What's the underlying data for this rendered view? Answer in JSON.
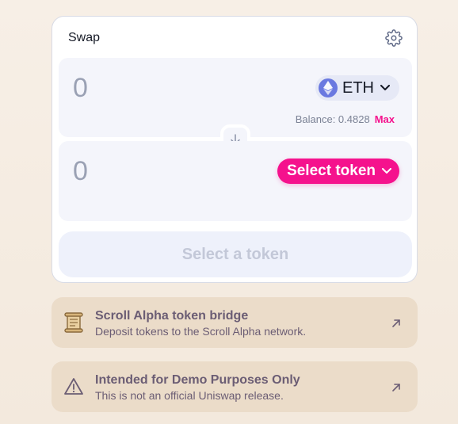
{
  "swap": {
    "title": "Swap",
    "input": {
      "amount": "0",
      "token": "ETH",
      "balance_label": "Balance: 0.4828",
      "max_label": "Max"
    },
    "output": {
      "amount": "0",
      "token_button": "Select token"
    },
    "action_button": "Select a token"
  },
  "banners": [
    {
      "title": "Scroll Alpha token bridge",
      "subtitle": "Deposit tokens to the Scroll Alpha network.",
      "icon": "scroll-icon"
    },
    {
      "title": "Intended for Demo Purposes Only",
      "subtitle": "This is not an official Uniswap release.",
      "icon": "warning-icon"
    }
  ],
  "colors": {
    "accent": "#f5128d",
    "banner_bg": "#ebdcc9",
    "banner_text": "#6b5d74",
    "panel_bg": "#f4f5fb"
  }
}
